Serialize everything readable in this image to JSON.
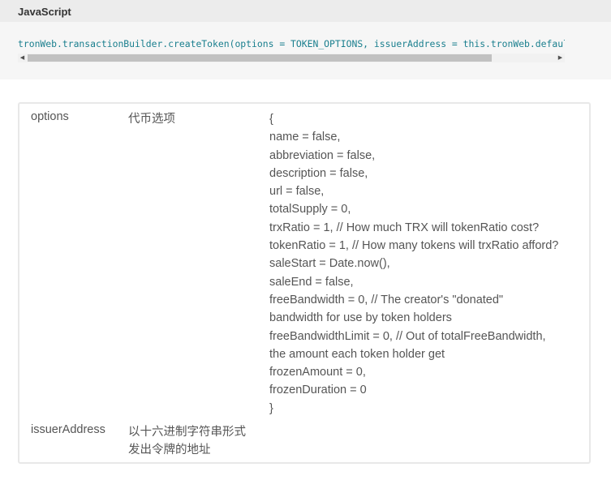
{
  "code_block": {
    "language": "JavaScript",
    "code": "tronWeb.transactionBuilder.createToken(options = TOKEN_OPTIONS, issuerAddress = this.tronWeb.defaultAddress.hex);",
    "scroll_left_glyph": "◀",
    "scroll_right_glyph": "▶"
  },
  "params": [
    {
      "name": "options",
      "description": "代币选项",
      "value_lines": [
        "{",
        "name = false,",
        "abbreviation = false,",
        "description = false,",
        "url = false,",
        "totalSupply = 0,",
        "trxRatio = 1, // How much TRX will tokenRatio cost?",
        "tokenRatio = 1, // How many tokens will trxRatio afford?",
        "saleStart = Date.now(),",
        "saleEnd = false,",
        "freeBandwidth = 0, // The creator's \"donated\"",
        "bandwidth for use by token holders",
        "freeBandwidthLimit = 0, // Out of totalFreeBandwidth,",
        "the amount each token holder get",
        "frozenAmount = 0,",
        "frozenDuration = 0",
        "}"
      ]
    },
    {
      "name": "issuerAddress",
      "description_lines": [
        "以十六进制字符串形式",
        "发出令牌的地址"
      ]
    }
  ]
}
